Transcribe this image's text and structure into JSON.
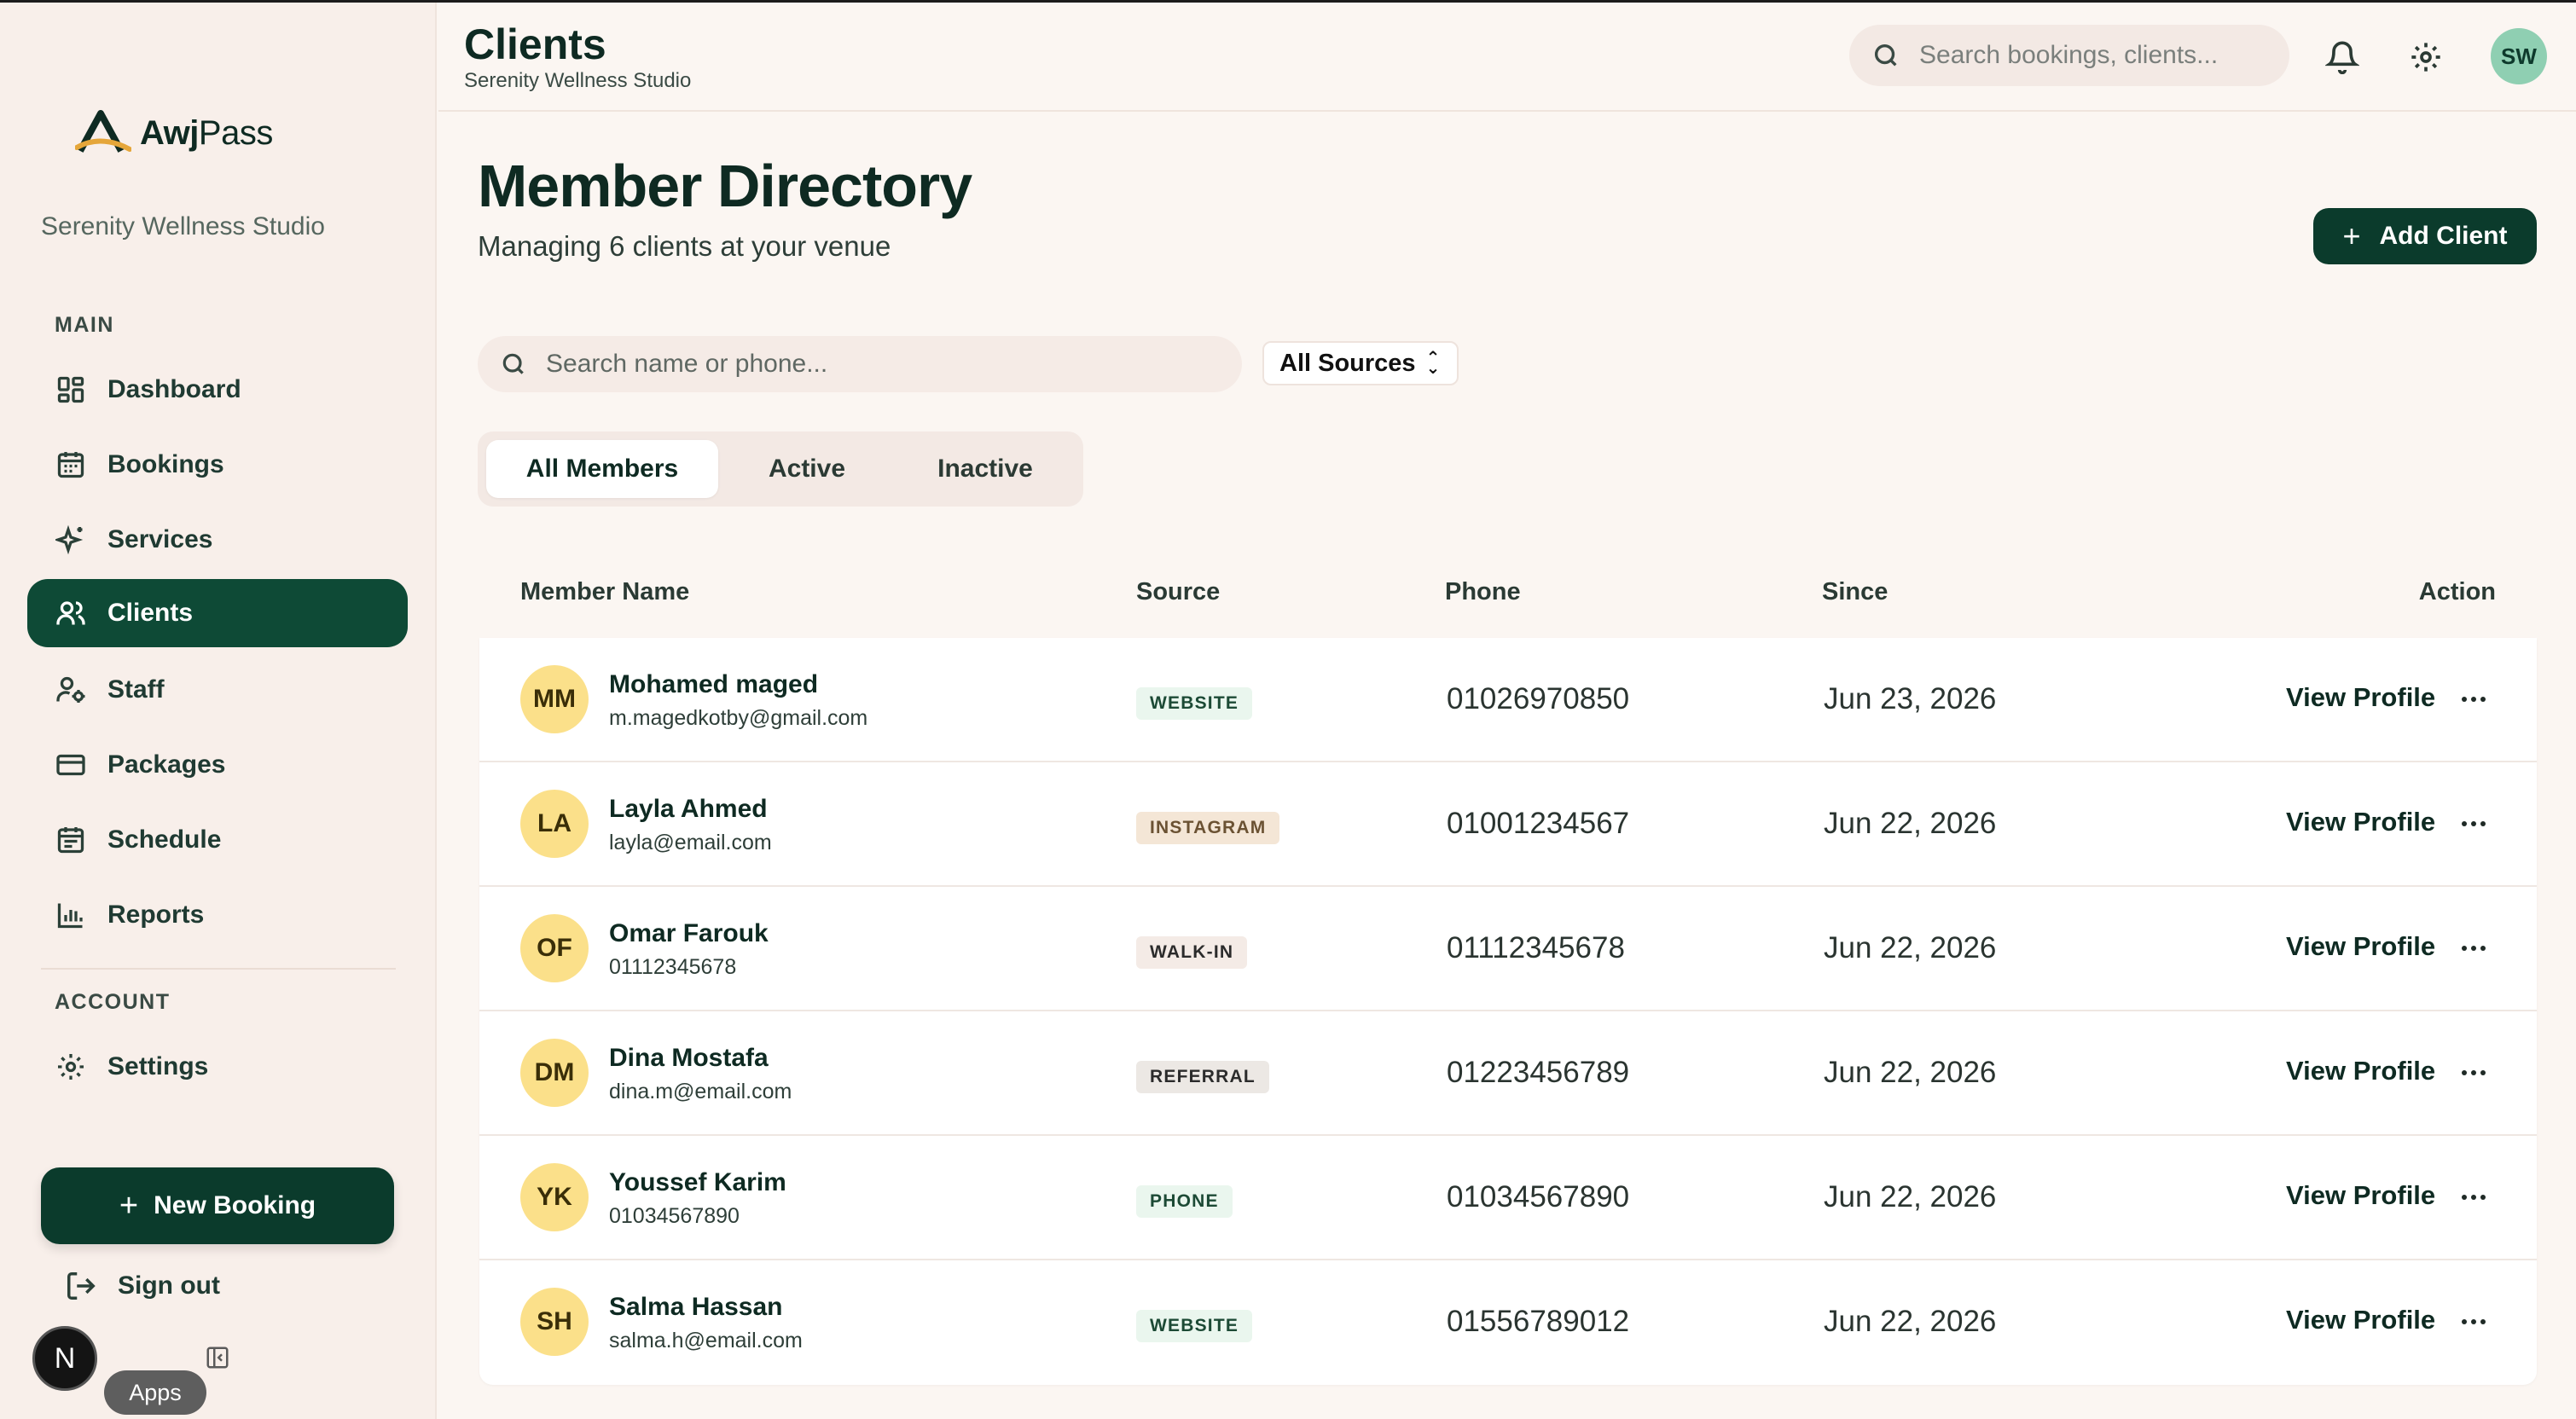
{
  "app": {
    "logo_text_bold": "Awj",
    "logo_text_light": "Pass",
    "venue": "Serenity Wellness Studio"
  },
  "sidebar": {
    "main_label": "MAIN",
    "account_label": "ACCOUNT",
    "items": [
      {
        "label": "Dashboard",
        "icon": "dashboard-icon"
      },
      {
        "label": "Bookings",
        "icon": "calendar-icon"
      },
      {
        "label": "Services",
        "icon": "sparkles-icon"
      },
      {
        "label": "Clients",
        "icon": "users-icon",
        "active": true
      },
      {
        "label": "Staff",
        "icon": "user-cog-icon"
      },
      {
        "label": "Packages",
        "icon": "card-icon"
      },
      {
        "label": "Schedule",
        "icon": "schedule-icon"
      },
      {
        "label": "Reports",
        "icon": "chart-icon"
      }
    ],
    "settings_label": "Settings",
    "new_booking_label": "New Booking",
    "sign_out_label": "Sign out",
    "n_badge": "N",
    "apps_tooltip": "Apps"
  },
  "header": {
    "title": "Clients",
    "subtitle": "Serenity Wellness Studio",
    "search_placeholder": "Search bookings, clients...",
    "avatar_initials": "SW"
  },
  "main": {
    "title": "Member Directory",
    "subtitle": "Managing 6 clients at your venue",
    "add_client_label": "Add Client",
    "search_placeholder": "Search name or phone...",
    "source_filter": "All Sources",
    "tabs": [
      {
        "label": "All Members",
        "active": true
      },
      {
        "label": "Active"
      },
      {
        "label": "Inactive"
      }
    ],
    "columns": {
      "name": "Member Name",
      "source": "Source",
      "phone": "Phone",
      "since": "Since",
      "action": "Action"
    },
    "view_profile_label": "View Profile",
    "source_colors": {
      "WEBSITE": {
        "bg": "#eaf6ee",
        "fg": "#1c4a35"
      },
      "INSTAGRAM": {
        "bg": "#f4e6d6",
        "fg": "#6b5233"
      },
      "WALK-IN": {
        "bg": "#f4ebe6",
        "fg": "#2b2b2b"
      },
      "REFERRAL": {
        "bg": "#ece8e4",
        "fg": "#2b2b2b"
      },
      "PHONE": {
        "bg": "#eaf6ee",
        "fg": "#1c4a35"
      }
    },
    "members": [
      {
        "initials": "MM",
        "name": "Mohamed maged",
        "contact": "m.magedkotby@gmail.com",
        "source": "WEBSITE",
        "phone": "01026970850",
        "since": "Jun 23, 2026"
      },
      {
        "initials": "LA",
        "name": "Layla Ahmed",
        "contact": "layla@email.com",
        "source": "INSTAGRAM",
        "phone": "01001234567",
        "since": "Jun 22, 2026"
      },
      {
        "initials": "OF",
        "name": "Omar Farouk",
        "contact": "01112345678",
        "source": "WALK-IN",
        "phone": "01112345678",
        "since": "Jun 22, 2026"
      },
      {
        "initials": "DM",
        "name": "Dina Mostafa",
        "contact": "dina.m@email.com",
        "source": "REFERRAL",
        "phone": "01223456789",
        "since": "Jun 22, 2026"
      },
      {
        "initials": "YK",
        "name": "Youssef Karim",
        "contact": "01034567890",
        "source": "PHONE",
        "phone": "01034567890",
        "since": "Jun 22, 2026"
      },
      {
        "initials": "SH",
        "name": "Salma Hassan",
        "contact": "salma.h@email.com",
        "source": "WEBSITE",
        "phone": "01556789012",
        "since": "Jun 22, 2026"
      }
    ]
  }
}
